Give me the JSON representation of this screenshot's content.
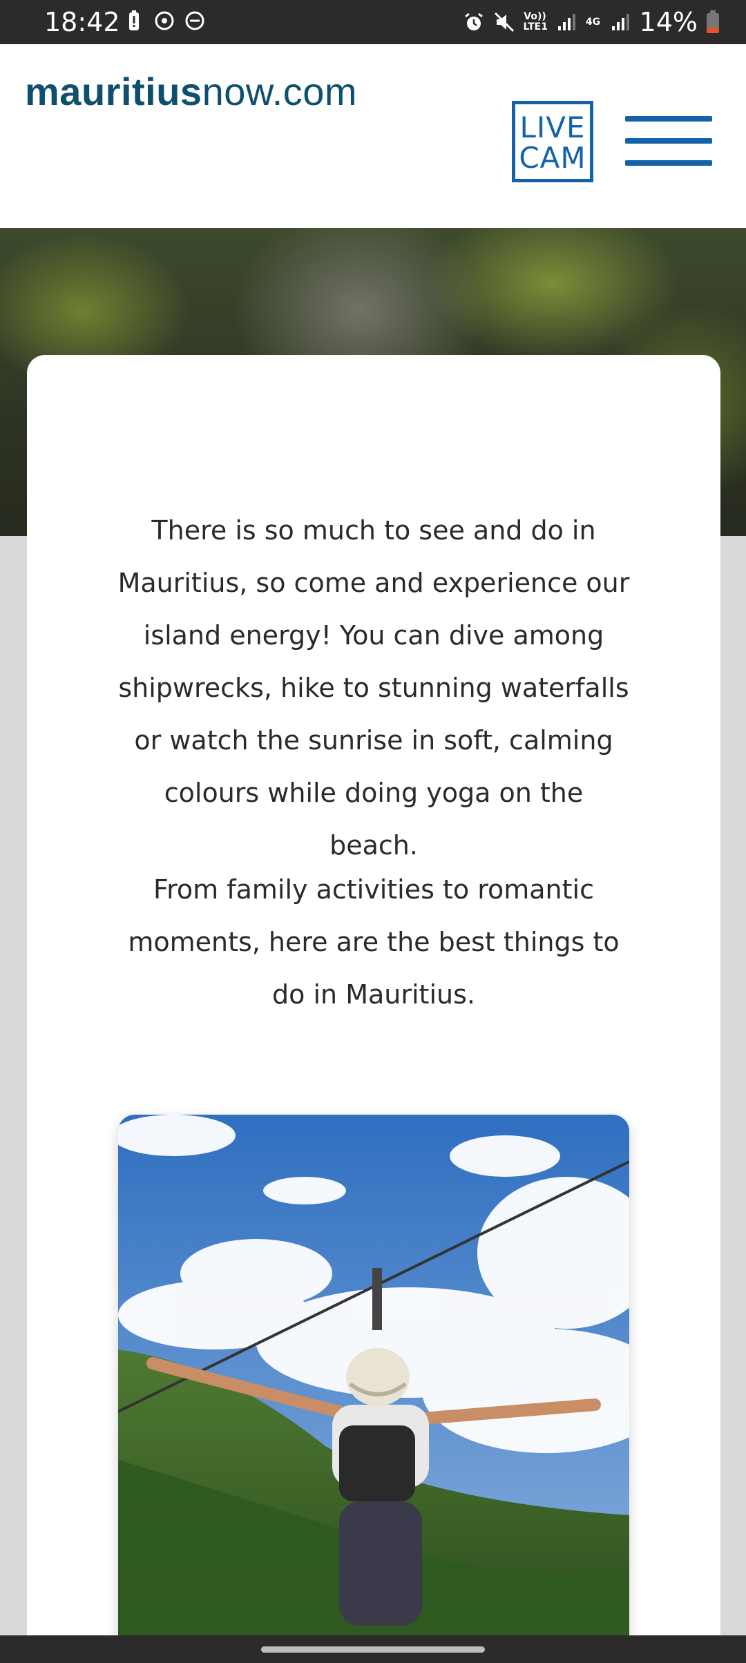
{
  "status_bar": {
    "time": "18:42",
    "battery_percent": "14%",
    "network_volte": "Vo)) LTE1",
    "network_type": "4G",
    "icons": [
      "battery-alert-icon",
      "sync-icon",
      "do-not-disturb-icon",
      "alarm-icon",
      "mute-icon",
      "signal-icon",
      "signal-icon",
      "battery-low-icon"
    ]
  },
  "header": {
    "logo_bold": "mauritius",
    "logo_light": "now.com",
    "live_cam_line1": "LIVE",
    "live_cam_line2": "CAM",
    "menu_icon": "hamburger-menu-icon"
  },
  "content": {
    "paragraph_1": "There is so much to see and do in Mauritius, so come and experience our island energy! You can dive among shipwrecks, hike to stunning waterfalls or watch the sunrise in soft, calming colours while doing yoga on the beach.",
    "paragraph_2": "From family activities to romantic moments, here are the best things to do in Mauritius."
  },
  "colors": {
    "brand_dark": "#0d4f6d",
    "accent_blue": "#1462a8",
    "page_bg": "#d9d9d9",
    "text": "#2a2a2a"
  }
}
